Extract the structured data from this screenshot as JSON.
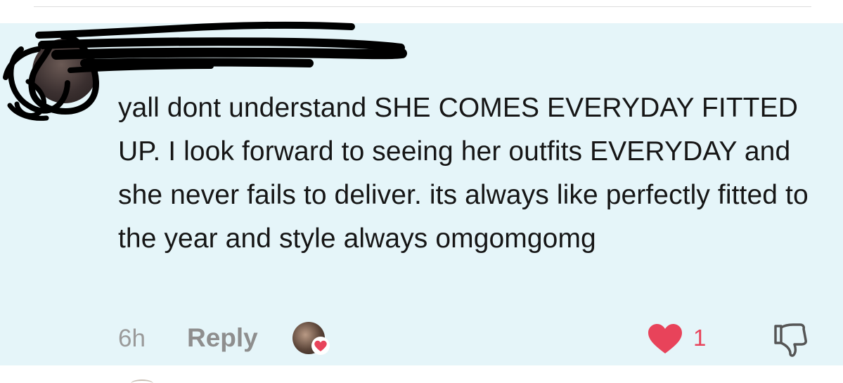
{
  "comment": {
    "username": "",
    "text": "yall dont understand SHE COMES EVERYDAY FITTED UP. I look forward to seeing her outfits EVERYDAY and she never fails to deliver. its always like perfectly fitted to the year and style always omgomgomg",
    "time": "6h",
    "reply_label": "Reply",
    "like_count": "1",
    "liked_by_creator": true
  },
  "icons": {
    "avatar": "user-avatar",
    "creator_avatar": "creator-avatar",
    "creator_heart": "heart-icon",
    "like": "heart-filled-icon",
    "dislike": "thumbs-down-icon"
  },
  "colors": {
    "card_background": "#e5f5f9",
    "text": "#161616",
    "secondary_text": "#9a9a9a",
    "like_red": "#e8435a"
  }
}
